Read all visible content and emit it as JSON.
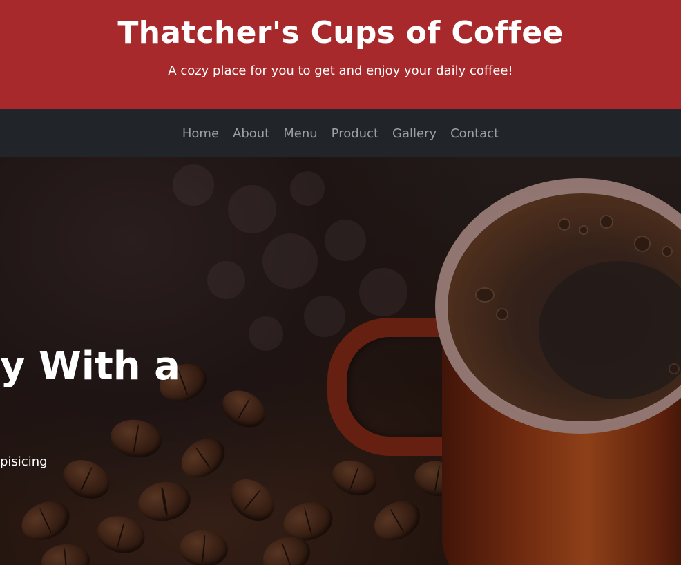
{
  "header": {
    "title": "Thatcher's Cups of Coffee",
    "tagline": "A cozy place for you to get and enjoy your daily coffee!",
    "background_color": "#a8292b"
  },
  "nav": {
    "background_color": "#212529",
    "items": [
      {
        "label": "Home"
      },
      {
        "label": "About"
      },
      {
        "label": "Menu"
      },
      {
        "label": "Product"
      },
      {
        "label": "Gallery"
      },
      {
        "label": "Contact"
      }
    ]
  },
  "hero": {
    "heading_visible": "y With a",
    "text_visible": "pisicing",
    "image": "coffee-cup-on-beans"
  }
}
